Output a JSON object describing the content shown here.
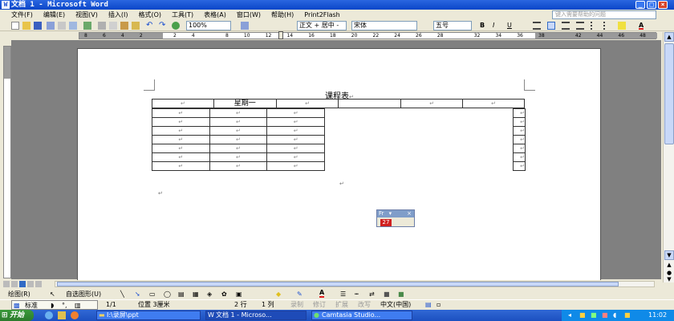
{
  "window": {
    "title": "文档 1 - Microsoft Word"
  },
  "menu": {
    "items": [
      "文件(F)",
      "编辑(E)",
      "视图(V)",
      "插入(I)",
      "格式(O)",
      "工具(T)",
      "表格(A)",
      "窗口(W)",
      "帮助(H)",
      "Print2Flash"
    ],
    "help_placeholder": "键入需要帮助的问题"
  },
  "toolbar": {
    "zoom": "100%",
    "style": "正文 + 居中 -",
    "font": "宋体",
    "size": "五号",
    "bold": "B",
    "italic": "I",
    "underline": "U",
    "font_color": "A"
  },
  "ruler": {
    "ticks": [
      "8",
      "6",
      "4",
      "2",
      "",
      "2",
      "4",
      "",
      "8",
      "10",
      "12",
      "14",
      "16",
      "18",
      "20",
      "22",
      "24",
      "26",
      "28",
      "",
      "32",
      "34",
      "36",
      "38",
      "",
      "42",
      "44",
      "46",
      "48"
    ]
  },
  "document": {
    "heading": "课程表",
    "return_mark": "↵",
    "header_cell": "星期一"
  },
  "floating_toolbar": {
    "title": "Fr",
    "icon": "27"
  },
  "drawbar": {
    "draw_label": "绘图(R)",
    "autoshape_label": "自选图形(U)"
  },
  "statusbar": {
    "ime": "标准",
    "page": "1/1",
    "position": "位置 3厘米",
    "line": "2 行",
    "col": "1 列",
    "rec": "录制",
    "trk": "修订",
    "ext": "扩展",
    "ovr": "改写",
    "lang": "中文(中国)"
  },
  "taskbar": {
    "start": "开始",
    "tasks": [
      "I:\\录屏\\ppt",
      "文档 1 - Microso...",
      "Camtasia Studio..."
    ],
    "clock": "11:02"
  }
}
